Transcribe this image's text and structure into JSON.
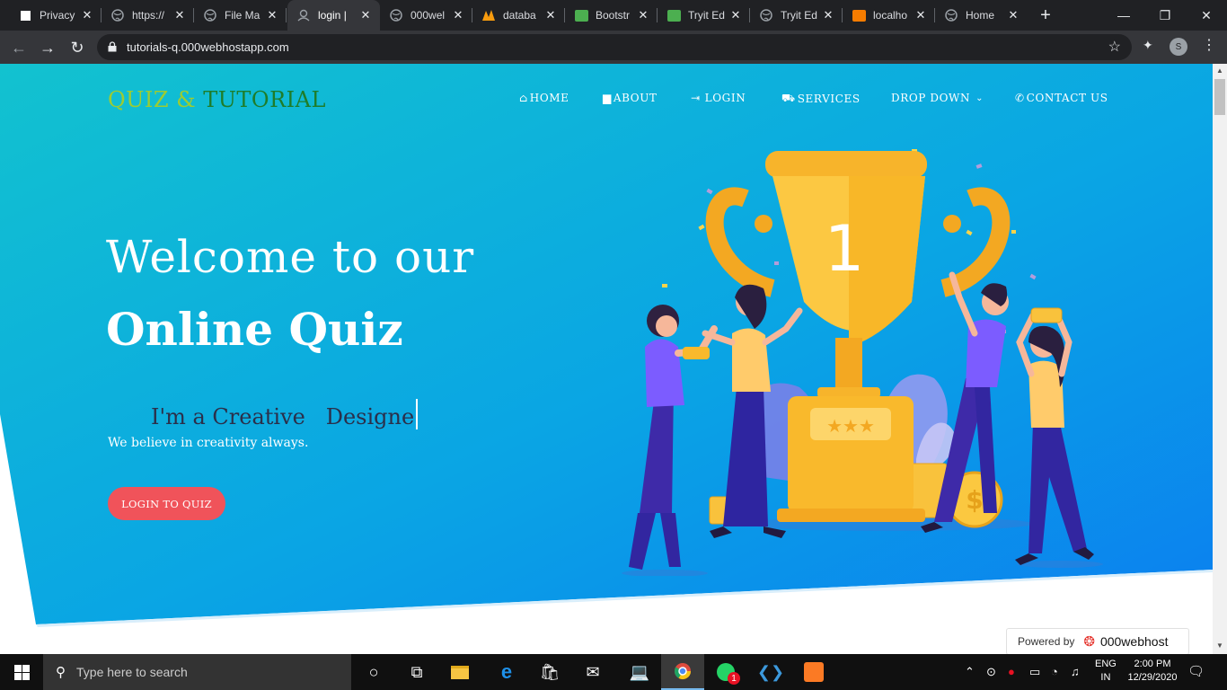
{
  "browser": {
    "tabs": [
      {
        "label": "Privacy",
        "icon": "page-icon"
      },
      {
        "label": "https://",
        "icon": "globe-icon"
      },
      {
        "label": "File Ma",
        "icon": "globe-icon"
      },
      {
        "label": "login | ",
        "icon": "user-icon",
        "active": true
      },
      {
        "label": "000wel",
        "icon": "globe-icon"
      },
      {
        "label": "databa",
        "icon": "phpmyadmin-icon"
      },
      {
        "label": "Bootstr",
        "icon": "w3schools-icon"
      },
      {
        "label": "Tryit Ed",
        "icon": "w3schools-icon"
      },
      {
        "label": "Tryit Ed",
        "icon": "globe-icon"
      },
      {
        "label": "localho",
        "icon": "xampp-icon"
      },
      {
        "label": "Home",
        "icon": "globe-icon"
      }
    ],
    "url": "tutorials-q.000webhostapp.com",
    "profile_initial": "S"
  },
  "site": {
    "brand_part1": "QUIZ & ",
    "brand_part2": "TUTORIAL",
    "nav": [
      {
        "label": "HOME",
        "icon": "home-icon"
      },
      {
        "label": "ABOUT",
        "icon": "book-icon"
      },
      {
        "label": "LOGIN",
        "icon": "sign-in-icon"
      },
      {
        "label": "SERVICES",
        "icon": "truck-icon"
      },
      {
        "label": "DROP DOWN",
        "icon": "chevron-down-icon"
      },
      {
        "label": "CONTACT US",
        "icon": "phone-icon"
      }
    ],
    "hero": {
      "welcome": "Welcome to our",
      "title": "Online Quiz",
      "typed_text": "I'm a Creative   Designe",
      "subtitle": "We believe in creativity always.",
      "cta": "LOGIN TO QUIZ",
      "trophy_number": "1"
    },
    "powered_by": "Powered by",
    "host_name": "000webhost"
  },
  "colors": {
    "hero_gradient_start": "#10bfd0",
    "hero_gradient_end": "#0a7fea",
    "brand_accent": "#9ccc32",
    "brand_dark": "#1e7d2a",
    "cta": "#f0535a"
  },
  "taskbar": {
    "search_placeholder": "Type here to search",
    "whatsapp_badge": "1",
    "lang_line1": "ENG",
    "lang_line2": "IN",
    "time": "2:00 PM",
    "date": "12/29/2020"
  }
}
